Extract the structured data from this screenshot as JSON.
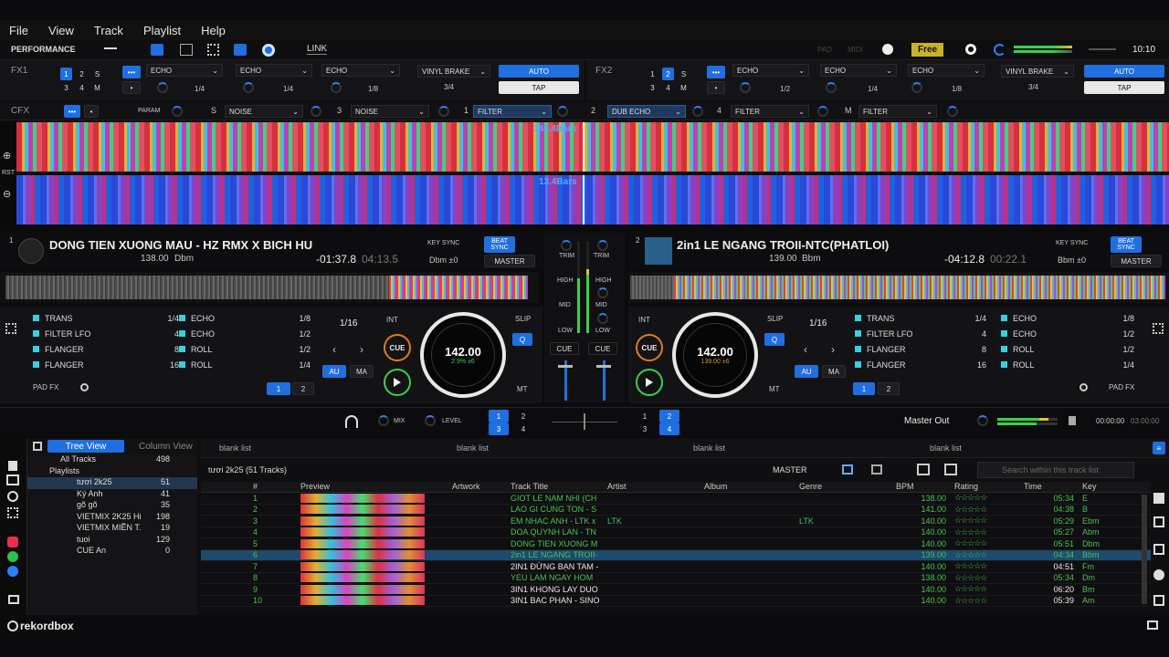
{
  "menu": [
    "File",
    "View",
    "Track",
    "Playlist",
    "Help"
  ],
  "topbar": {
    "mode": "PERFORMANCE",
    "link": "LINK",
    "pad": "PAD",
    "midi": "MIDI",
    "free": "Free",
    "time": "10:10"
  },
  "fx1": {
    "label": "FX1",
    "nums": [
      "1",
      "2",
      "S",
      "3",
      "4",
      "M"
    ],
    "slots": [
      {
        "name": "ECHO",
        "beat": "1/4"
      },
      {
        "name": "ECHO",
        "beat": "1/4"
      },
      {
        "name": "ECHO",
        "beat": "1/8"
      }
    ],
    "vinyl": "VINYL BRAKE",
    "vinyl_beat": "3/4",
    "auto": "AUTO",
    "tap": "TAP"
  },
  "fx2": {
    "label": "FX2",
    "nums": [
      "1",
      "2",
      "S",
      "3",
      "4",
      "M"
    ],
    "slots": [
      {
        "name": "ECHO",
        "beat": "1/2"
      },
      {
        "name": "ECHO",
        "beat": "1/4"
      },
      {
        "name": "ECHO",
        "beat": "1/8"
      }
    ],
    "vinyl": "VINYL BRAKE",
    "vinyl_beat": "3/4",
    "auto": "AUTO",
    "tap": "TAP"
  },
  "cfx": {
    "label": "CFX",
    "param": "PARAM",
    "items": [
      {
        "k": "S",
        "v": "NOISE"
      },
      {
        "k": "3",
        "v": "NOISE"
      },
      {
        "k": "1",
        "v": "FILTER"
      },
      {
        "k": "2",
        "v": "DUB ECHO"
      },
      {
        "k": "4",
        "v": "FILTER"
      },
      {
        "k": "M",
        "v": "FILTER"
      }
    ]
  },
  "waves": {
    "top_label": "146.4Bars",
    "bottom_label": "13.4Bars",
    "rst": "RST"
  },
  "deck1": {
    "num": "1",
    "title": "DONG TIEN XUONG MAU - HZ RMX X BICH HU",
    "bpm": "138.00",
    "key": "Dbm",
    "remain": "-01:37.8",
    "elapsed": "04:13.5",
    "key_sync": "KEY SYNC",
    "beat_sync": "BEAT SYNC",
    "master": "MASTER",
    "key_adj": "Dbm ±0",
    "beatjump": "1/16",
    "int": "INT",
    "slip": "SLIP",
    "q": "Q",
    "cue": "CUE",
    "au": "AU",
    "ma": "MA",
    "mt": "MT",
    "jog_bpm": "142.00",
    "jog_pct": "2.9%",
    "jog_r": "±6",
    "pad_fx": "PAD FX",
    "pads": [
      [
        "TRANS",
        "1/4",
        "ECHO",
        "1/8"
      ],
      [
        "FILTER LFO",
        "4",
        "ECHO",
        "1/2"
      ],
      [
        "FLANGER",
        "8",
        "ROLL",
        "1/2"
      ],
      [
        "FLANGER",
        "16",
        "ROLL",
        "1/4"
      ]
    ]
  },
  "deck2": {
    "num": "2",
    "title": "2in1 LE NGANG TROII-NTC(PHATLOI)",
    "bpm": "139.00",
    "key": "Bbm",
    "remain": "-04:12.8",
    "elapsed": "00:22.1",
    "key_sync": "KEY SYNC",
    "beat_sync": "BEAT SYNC",
    "master": "MASTER",
    "key_adj": "Bbm ±0",
    "beatjump": "1/16",
    "int": "INT",
    "slip": "SLIP",
    "q": "Q",
    "cue": "CUE",
    "au": "AU",
    "ma": "MA",
    "mt": "MT",
    "jog_bpm": "142.00",
    "jog_pct": "139.00",
    "jog_r": "±6",
    "pad_fx": "PAD FX",
    "pads": [
      [
        "TRANS",
        "1/4",
        "ECHO",
        "1/8"
      ],
      [
        "FILTER LFO",
        "4",
        "ECHO",
        "1/2"
      ],
      [
        "FLANGER",
        "8",
        "ROLL",
        "1/2"
      ],
      [
        "FLANGER",
        "16",
        "ROLL",
        "1/4"
      ]
    ]
  },
  "mixer": {
    "trim": "TRIM",
    "high": "HIGH",
    "mid": "MID",
    "low": "LOW",
    "cue": "CUE"
  },
  "bottom": {
    "mix": "MIX",
    "level": "LEVEL",
    "master_out": "Master Out",
    "time": "00:00:00",
    "time2": "03:00:00"
  },
  "browser": {
    "tree_view": "Tree View",
    "column_view": "Column View",
    "tree": [
      {
        "name": "All Tracks",
        "count": "498"
      },
      {
        "name": "Playlists",
        "count": ""
      },
      {
        "name": "tươi 2k25",
        "count": "51"
      },
      {
        "name": "Ký Anh",
        "count": "41"
      },
      {
        "name": "gõ gõ",
        "count": "35"
      },
      {
        "name": "VIETMIX 2K25 Hi",
        "count": "198"
      },
      {
        "name": "VIETMIX MIỀN T.",
        "count": "19"
      },
      {
        "name": "tuoi",
        "count": "129"
      },
      {
        "name": "CUE An",
        "count": "0"
      }
    ],
    "tabs": [
      "blank list",
      "blank list",
      "blank list",
      "blank list"
    ],
    "list_title": "tươi 2k25 (51 Tracks)",
    "master": "MASTER",
    "search": "Search within this track list",
    "cols": [
      "#",
      "Preview",
      "Artwork",
      "Track Title",
      "Artist",
      "Album",
      "Genre",
      "BPM",
      "Rating",
      "Time",
      "Key"
    ],
    "rows": [
      {
        "n": "1",
        "title": "GIOT LE NAM NHI (CH",
        "artist": "",
        "genre": "",
        "bpm": "138.00",
        "time": "05:34",
        "key": "E",
        "color": "#49c24e"
      },
      {
        "n": "2",
        "title": "LAO GI CUNG TON - S",
        "artist": "",
        "genre": "",
        "bpm": "141.00",
        "time": "04:38",
        "key": "B",
        "color": "#49c24e"
      },
      {
        "n": "3",
        "title": "EM NHAC ANH - LTK x",
        "artist": "LTK",
        "genre": "LTK",
        "bpm": "140.00",
        "time": "05:29",
        "key": "Ebm",
        "color": "#49c24e"
      },
      {
        "n": "4",
        "title": "DOA QUYNH LAN - TN",
        "artist": "",
        "genre": "",
        "bpm": "140.00",
        "time": "05:27",
        "key": "Abm",
        "color": "#49c24e"
      },
      {
        "n": "5",
        "title": "DONG TIEN XUONG M",
        "artist": "",
        "genre": "",
        "bpm": "140.00",
        "time": "05:51",
        "key": "Dbm",
        "color": "#49c24e"
      },
      {
        "n": "6",
        "title": "2in1 LE NGANG TROII-",
        "artist": "",
        "genre": "",
        "bpm": "139.00",
        "time": "04:34",
        "key": "Bbm",
        "color": "#49c24e",
        "sel": true
      },
      {
        "n": "7",
        "title": "2IN1 ĐỪNG BẠN TAM -",
        "artist": "",
        "genre": "",
        "bpm": "140.00",
        "time": "04:51",
        "key": "Fm",
        "color": "#e8e8e8"
      },
      {
        "n": "8",
        "title": "YEU LAM NGAY HOM",
        "artist": "",
        "genre": "",
        "bpm": "138.00",
        "time": "05:34",
        "key": "Dm",
        "color": "#49c24e"
      },
      {
        "n": "9",
        "title": "3IN1 KHONG LAY DUO",
        "artist": "",
        "genre": "",
        "bpm": "140.00",
        "time": "06:20",
        "key": "Bm",
        "color": "#e8e8e8"
      },
      {
        "n": "10",
        "title": "3IN1 BAC PHAN - SINO",
        "artist": "",
        "genre": "",
        "bpm": "140.00",
        "time": "05:39",
        "key": "Am",
        "color": "#e8e8e8"
      }
    ]
  },
  "footer": {
    "logo": "rekordbox"
  }
}
